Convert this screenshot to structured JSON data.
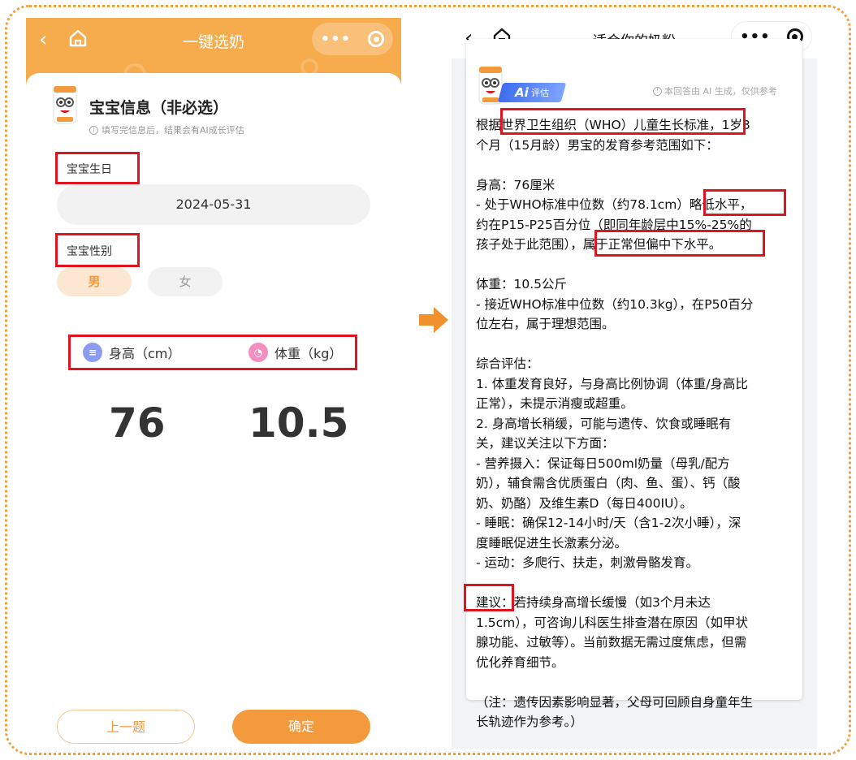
{
  "left": {
    "nav_title": "一键选奶",
    "section_title": "宝宝信息（非必选）",
    "section_hint": "填写完信息后，结果会有AI成长评估",
    "birthday_label": "宝宝生日",
    "birthday_value": "2024-05-31",
    "gender_label": "宝宝性别",
    "gender_options": [
      "男",
      "女"
    ],
    "gender_selected": "男",
    "height_label": "身高（cm）",
    "weight_label": "体重（kg）",
    "height_value": "76",
    "weight_value": "10.5",
    "prev_button": "上一题",
    "confirm_button": "确定"
  },
  "right": {
    "nav_title": "适合你的奶粉",
    "ai_badge_big": "Ai",
    "ai_badge_small": "评估",
    "disclaimer": "本回答由 AI 生成，仅供参考",
    "lines": [
      "根据世界卫生组织（WHO）儿童生长标准，1岁3",
      "个月（15月龄）男宝的发育参考范围如下：",
      "",
      "身高：76厘米",
      "- 处于WHO标准中位数（约78.1cm）略低水平，",
      "约在P15-P25百分位（即同年龄层中15%-25%的",
      "孩子处于此范围），属于正常但偏中下水平。",
      "",
      "体重：10.5公斤",
      "- 接近WHO标准中位数（约10.3kg），在P50百分",
      "位左右，属于理想范围。",
      "",
      "综合评估：",
      "1. 体重发育良好，与身高比例协调（体重/身高比",
      "正常），未提示消瘦或超重。",
      "2. 身高增长稍缓，可能与遗传、饮食或睡眠有",
      "关，建议关注以下方面：",
      "  - 营养摄入：保证每日500ml奶量（母乳/配方",
      "奶），辅食需含优质蛋白（肉、鱼、蛋）、钙（酸",
      "奶、奶酪）及维生素D（每日400IU）。",
      "  - 睡眠：确保12-14小时/天（含1-2次小睡），深",
      "度睡眠促进生长激素分泌。",
      "  - 运动：多爬行、扶走，刺激骨骼发育。",
      "",
      "建议：若持续身高增长缓慢（如3个月未达",
      "1.5cm），可咨询儿科医生排查潜在原因（如甲状",
      "腺功能、过敏等）。当前数据无需过度焦虑，但需",
      "优化养育细节。",
      "",
      "（注：遗传因素影响显著，父母可回顾自身童年生",
      "长轨迹作为参考。）"
    ]
  },
  "colors": {
    "frame": "#f0a040",
    "header": "#f6ab4c",
    "accent": "#f29a3c",
    "highlight": "#e0141e",
    "ai_blue": "#3d6cf0"
  }
}
